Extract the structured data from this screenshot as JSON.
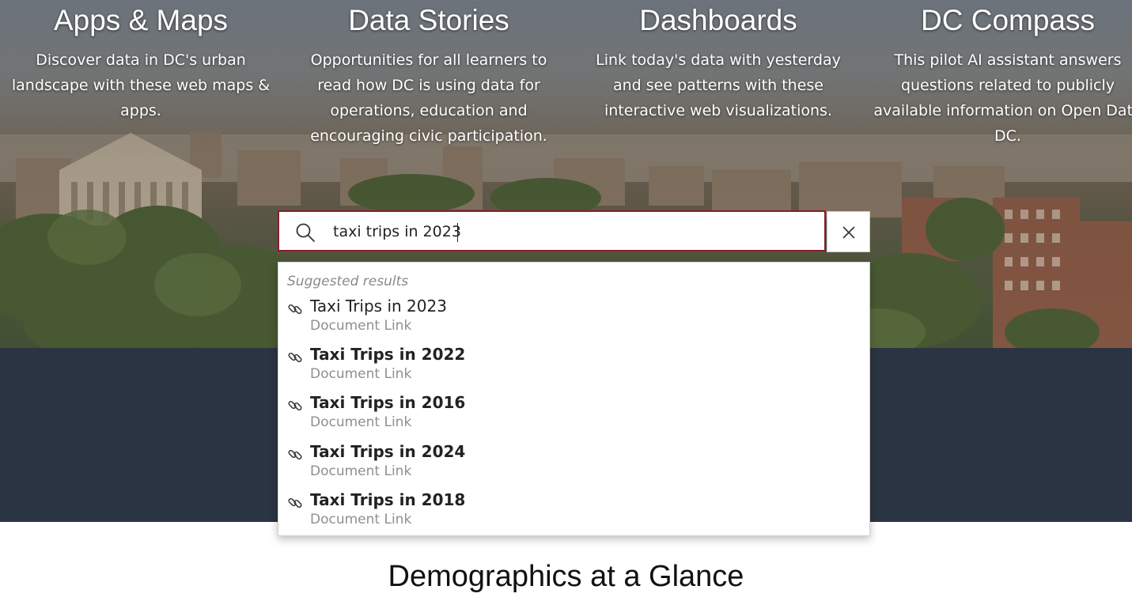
{
  "features": [
    {
      "title": "Apps & Maps",
      "description": "Discover data in DC's urban landscape with these web maps & apps."
    },
    {
      "title": "Data Stories",
      "description": "Opportunities for all learners to read how DC is using data for operations, education and encouraging civic participation."
    },
    {
      "title": "Dashboards",
      "description": "Link today's data with yesterday and see patterns with these interactive web visualizations."
    },
    {
      "title": "DC Compass",
      "description": "This pilot AI assistant answers questions related to publicly available information on Open Data DC."
    }
  ],
  "search": {
    "value": "taxi trips in 2023",
    "icon": "search-icon",
    "clear_icon": "close-icon"
  },
  "suggestions": {
    "header": "Suggested results",
    "items": [
      {
        "title": "Taxi Trips in 2023",
        "type": "Document Link",
        "icon": "link-icon",
        "bold": false
      },
      {
        "title": "Taxi Trips in 2022",
        "type": "Document Link",
        "icon": "link-icon",
        "bold": true
      },
      {
        "title": "Taxi Trips in 2016",
        "type": "Document Link",
        "icon": "link-icon",
        "bold": true
      },
      {
        "title": "Taxi Trips in 2024",
        "type": "Document Link",
        "icon": "link-icon",
        "bold": true
      },
      {
        "title": "Taxi Trips in 2018",
        "type": "Document Link",
        "icon": "link-icon",
        "bold": true
      }
    ]
  },
  "section": {
    "heading": "Demographics at a Glance"
  },
  "colors": {
    "search_border": "#8a1e2a",
    "dark_band": "#2b3443"
  }
}
